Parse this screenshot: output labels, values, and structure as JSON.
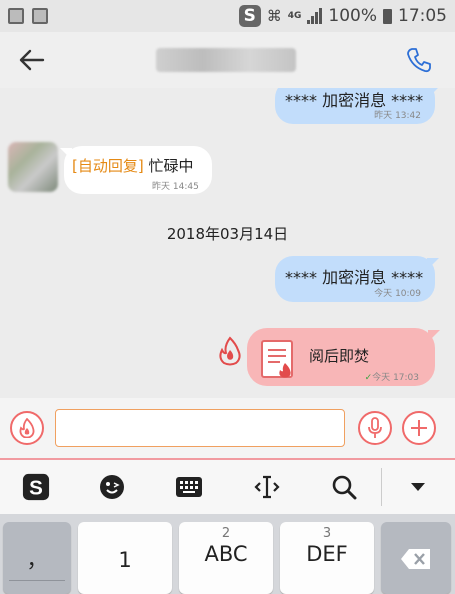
{
  "status_bar": {
    "network": "4G",
    "battery": "100%",
    "time": "17:05",
    "ime_badge": "S"
  },
  "header": {
    "back_icon": "arrow-left-icon",
    "call_icon": "phone-icon"
  },
  "messages": [
    {
      "side": "right",
      "text": "**** 加密消息 ****",
      "day": "昨天",
      "time": "13:42"
    },
    {
      "side": "left",
      "prefix": "[自动回复]",
      "text": "忙碌中",
      "day": "昨天",
      "time": "14:45"
    },
    {
      "type": "date_separator",
      "text": "2018年03月14日"
    },
    {
      "side": "right",
      "text": "**** 加密消息 ****",
      "day": "今天",
      "time": "10:09"
    },
    {
      "side": "right",
      "type": "burn_after_reading",
      "text": "阅后即焚",
      "day": "今天",
      "time": "17:03"
    }
  ],
  "input": {
    "value": "",
    "placeholder": ""
  },
  "ime_toolbar": [
    "sogou-logo-icon",
    "emoji-icon",
    "keyboard-icon",
    "cursor-icon",
    "search-icon",
    "collapse-icon"
  ],
  "keyboard": {
    "keys": [
      {
        "main": "，",
        "num": ""
      },
      {
        "main": "1",
        "num": ""
      },
      {
        "main": "ABC",
        "num": "2"
      },
      {
        "main": "DEF",
        "num": "3"
      }
    ]
  },
  "colors": {
    "sent_bubble": "#c2ddfb",
    "burn_bubble": "#f8b6b7",
    "auto_reply": "#e58a15",
    "accent_red": "#f06a6a"
  }
}
